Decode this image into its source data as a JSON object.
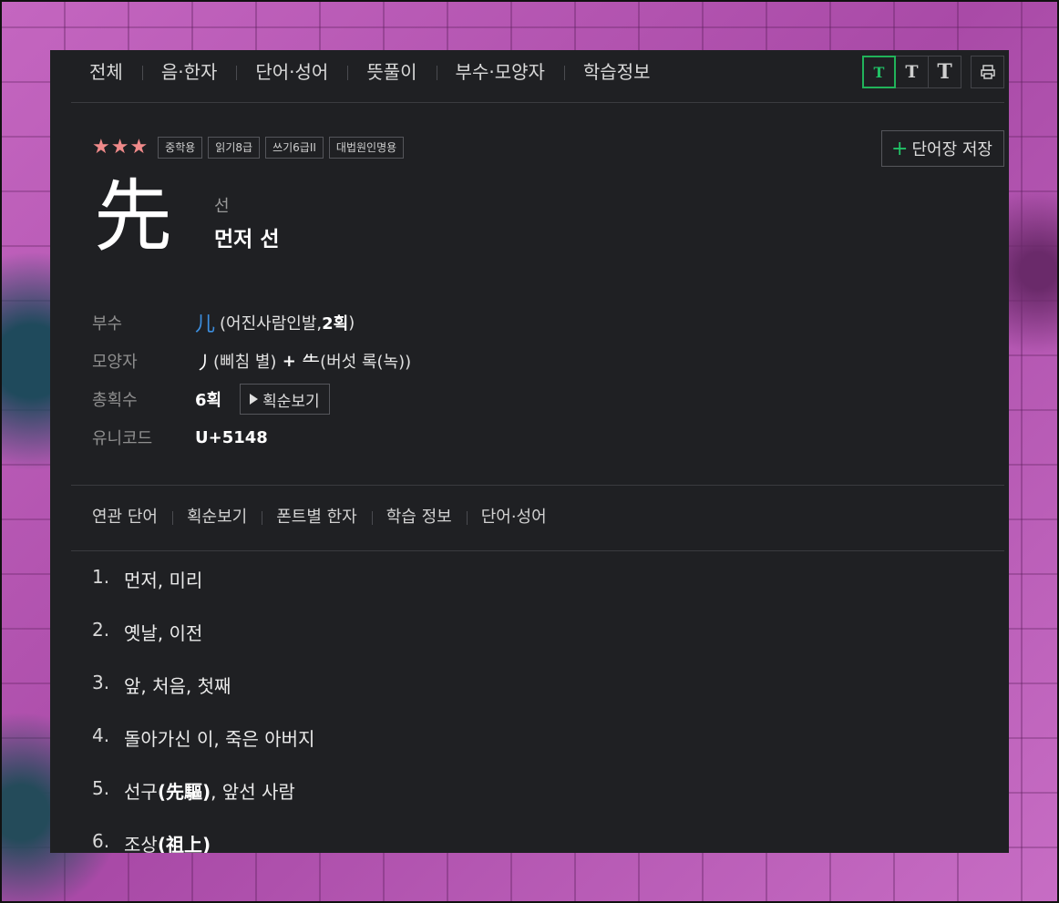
{
  "nav": {
    "tabs": [
      "전체",
      "음·한자",
      "단어·성어",
      "뜻풀이",
      "부수·모양자",
      "학습정보"
    ],
    "font_size_tools": [
      "T",
      "T",
      "T"
    ],
    "print_icon": "print-icon"
  },
  "hanja": {
    "stars": "★★★",
    "badges": [
      "중학용",
      "읽기8급",
      "쓰기6급II",
      "대법원인명용"
    ],
    "save_label": "단어장 저장",
    "character": "先",
    "reading": "선",
    "meaning": "먼저 선"
  },
  "info": {
    "radical": {
      "label": "부수",
      "char": "儿",
      "detail_open": "(어진사람인발, ",
      "strokes": "2획",
      "detail_close": ")"
    },
    "shape": {
      "label": "모양자",
      "part1": "丿",
      "part1_name": "(삐침 별)",
      "plus": " + ",
      "part2": "⺧",
      "part2_name": "(버섯 록(녹))"
    },
    "total_strokes": {
      "label": "총획수",
      "value": "6획",
      "button": "획순보기"
    },
    "unicode": {
      "label": "유니코드",
      "value": "U+5148"
    }
  },
  "sections": [
    "연관 단어",
    "획순보기",
    "폰트별 한자",
    "학습 정보",
    "단어·성어"
  ],
  "meanings": [
    {
      "num": "1.",
      "text": "먼저, 미리"
    },
    {
      "num": "2.",
      "text": "옛날, 이전"
    },
    {
      "num": "3.",
      "text": "앞, 처음, 첫째"
    },
    {
      "num": "4.",
      "text": "돌아가신 이, 죽은 아버지"
    },
    {
      "num": "5.",
      "pre": "선구",
      "hanja": "(先驅)",
      "post": ", 앞선 사람"
    },
    {
      "num": "6.",
      "pre": "조상",
      "hanja": "(祖上)",
      "post": ""
    }
  ],
  "colors": {
    "accent_green": "#21c266",
    "link_blue": "#3d8fe0",
    "stars": "#f08a8a",
    "panel_bg": "#1f2023"
  }
}
